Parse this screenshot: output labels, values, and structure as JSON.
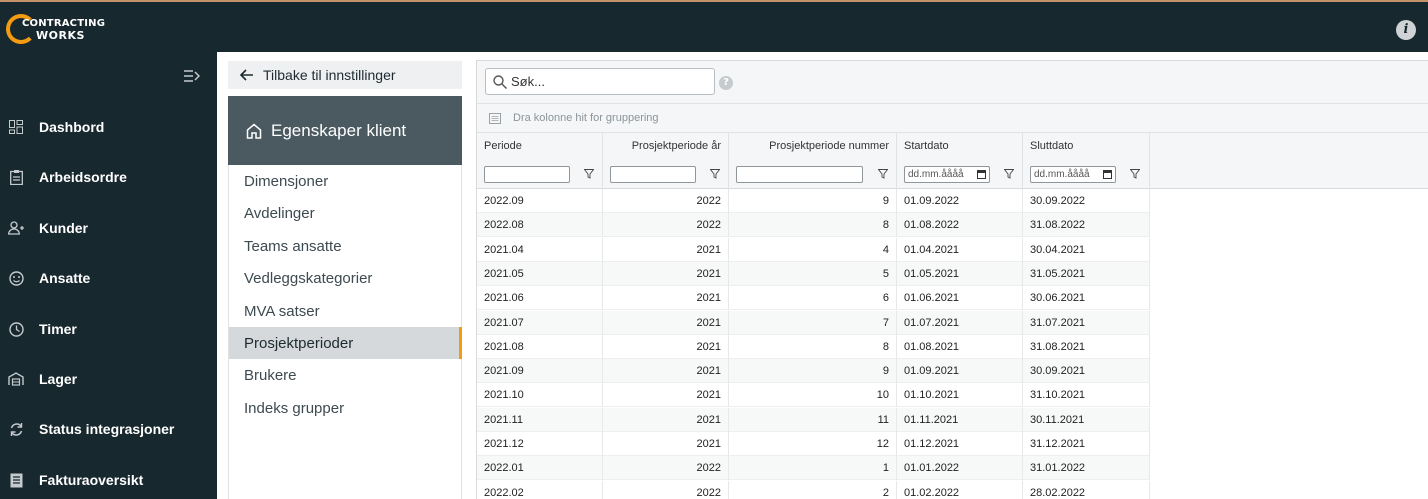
{
  "app": {
    "logo_line1": "CONTRACTING",
    "logo_line2": "WORKS",
    "accent_color": "#f39c12",
    "topbar_color": "#18282f"
  },
  "sidebar": {
    "items": [
      {
        "label": "Dashbord",
        "icon": "dashboard-icon"
      },
      {
        "label": "Arbeidsordre",
        "icon": "clipboard-icon"
      },
      {
        "label": "Kunder",
        "icon": "users-icon"
      },
      {
        "label": "Ansatte",
        "icon": "smiley-icon"
      },
      {
        "label": "Timer",
        "icon": "clock-icon"
      },
      {
        "label": "Lager",
        "icon": "warehouse-icon"
      },
      {
        "label": "Status integrasjoner",
        "icon": "sync-icon"
      },
      {
        "label": "Fakturaoversikt",
        "icon": "invoice-icon"
      }
    ]
  },
  "settings": {
    "back_label": "Tilbake til innstillinger",
    "panel_title": "Egenskaper klient",
    "menu": [
      {
        "label": "Dimensjoner",
        "active": false
      },
      {
        "label": "Avdelinger",
        "active": false
      },
      {
        "label": "Teams ansatte",
        "active": false
      },
      {
        "label": "Vedleggskategorier",
        "active": false
      },
      {
        "label": "MVA satser",
        "active": false
      },
      {
        "label": "Prosjektperioder",
        "active": true
      },
      {
        "label": "Brukere",
        "active": false
      },
      {
        "label": "Indeks grupper",
        "active": false
      }
    ]
  },
  "grid": {
    "search_placeholder": "Søk...",
    "help": "?",
    "group_hint": "Dra kolonne hit for gruppering",
    "date_placeholder": "dd.mm.åååå",
    "columns": [
      "Periode",
      "Prosjektperiode år",
      "Prosjektperiode nummer",
      "Startdato",
      "Sluttdato"
    ],
    "rows": [
      [
        "2022.09",
        "2022",
        "9",
        "01.09.2022",
        "30.09.2022"
      ],
      [
        "2022.08",
        "2022",
        "8",
        "01.08.2022",
        "31.08.2022"
      ],
      [
        "2021.04",
        "2021",
        "4",
        "01.04.2021",
        "30.04.2021"
      ],
      [
        "2021.05",
        "2021",
        "5",
        "01.05.2021",
        "31.05.2021"
      ],
      [
        "2021.06",
        "2021",
        "6",
        "01.06.2021",
        "30.06.2021"
      ],
      [
        "2021.07",
        "2021",
        "7",
        "01.07.2021",
        "31.07.2021"
      ],
      [
        "2021.08",
        "2021",
        "8",
        "01.08.2021",
        "31.08.2021"
      ],
      [
        "2021.09",
        "2021",
        "9",
        "01.09.2021",
        "30.09.2021"
      ],
      [
        "2021.10",
        "2021",
        "10",
        "01.10.2021",
        "31.10.2021"
      ],
      [
        "2021.11",
        "2021",
        "11",
        "01.11.2021",
        "30.11.2021"
      ],
      [
        "2021.12",
        "2021",
        "12",
        "01.12.2021",
        "31.12.2021"
      ],
      [
        "2022.01",
        "2022",
        "1",
        "01.01.2022",
        "31.01.2022"
      ],
      [
        "2022.02",
        "2022",
        "2",
        "01.02.2022",
        "28.02.2022"
      ]
    ]
  }
}
